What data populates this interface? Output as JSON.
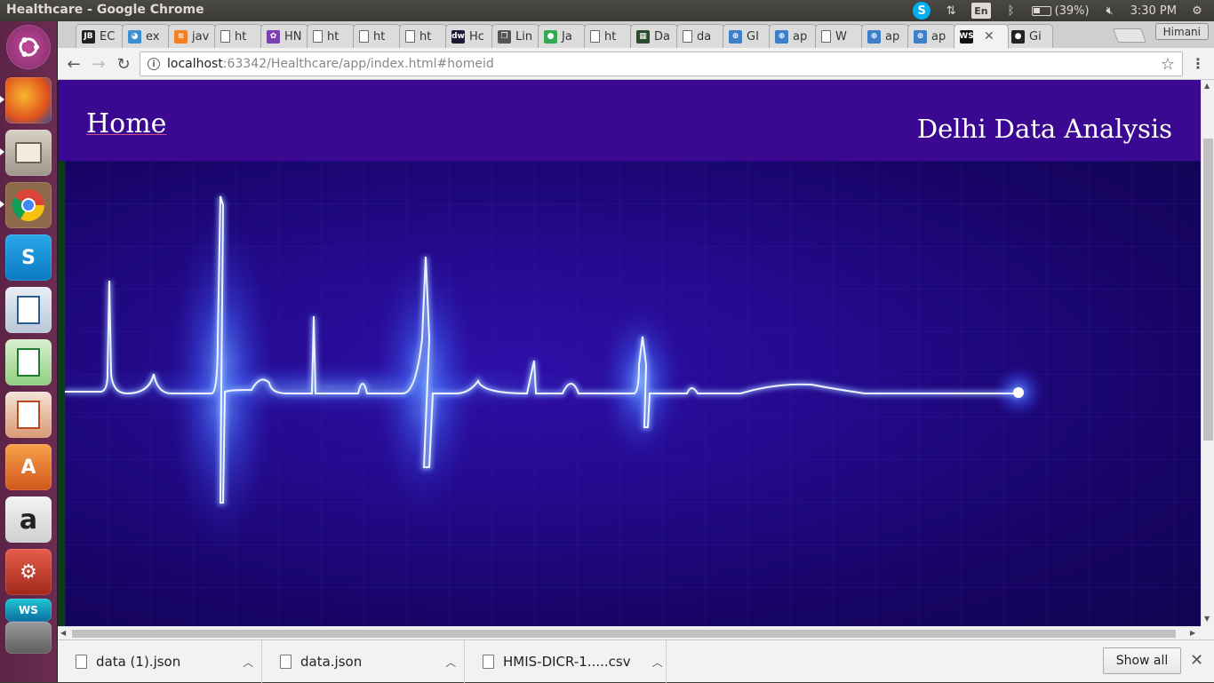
{
  "system_bar": {
    "window_title": "Healthcare - Google Chrome",
    "lang": "En",
    "battery": "(39%)",
    "clock": "3:30 PM"
  },
  "launcher": {
    "items": [
      "ubuntu-dash",
      "firefox",
      "files",
      "chrome",
      "skype",
      "libreoffice-writer",
      "libreoffice-calc",
      "libreoffice-impress",
      "software-center",
      "amazon",
      "system-settings",
      "webstorm",
      "disk"
    ]
  },
  "browser": {
    "tabs": [
      {
        "label": "EC",
        "icon": "jetbrains-icon"
      },
      {
        "label": "ex",
        "icon": "globe-icon"
      },
      {
        "label": "jav",
        "icon": "stackoverflow-icon"
      },
      {
        "label": "ht",
        "icon": "doc-icon"
      },
      {
        "label": "HN",
        "icon": "hmis-icon"
      },
      {
        "label": "ht",
        "icon": "doc-icon"
      },
      {
        "label": "ht",
        "icon": "doc-icon"
      },
      {
        "label": "ht",
        "icon": "doc-icon"
      },
      {
        "label": "Hc",
        "icon": "dw-icon"
      },
      {
        "label": "Lin",
        "icon": "book-icon"
      },
      {
        "label": "Ja",
        "icon": "chrome-icon"
      },
      {
        "label": "ht",
        "icon": "doc-icon"
      },
      {
        "label": "Da",
        "icon": "data-icon"
      },
      {
        "label": "da",
        "icon": "doc-icon"
      },
      {
        "label": "GI",
        "icon": "who-icon"
      },
      {
        "label": "ap",
        "icon": "who-icon"
      },
      {
        "label": "W",
        "icon": "doc-icon"
      },
      {
        "label": "ap",
        "icon": "who-icon"
      },
      {
        "label": "ap",
        "icon": "who-icon"
      },
      {
        "label": "",
        "icon": "webstorm-icon",
        "active": true
      },
      {
        "label": "Gi",
        "icon": "github-icon"
      }
    ],
    "profile": "Himani",
    "url_host": "localhost",
    "url_path": ":63342/Healthcare/app/index.html#homeid"
  },
  "page": {
    "nav_home": "Home",
    "site_title": "Delhi Data Analysis"
  },
  "downloads": {
    "items": [
      "data (1).json",
      "data.json",
      "HMIS-DICR-1.....csv"
    ],
    "show_all": "Show all"
  }
}
